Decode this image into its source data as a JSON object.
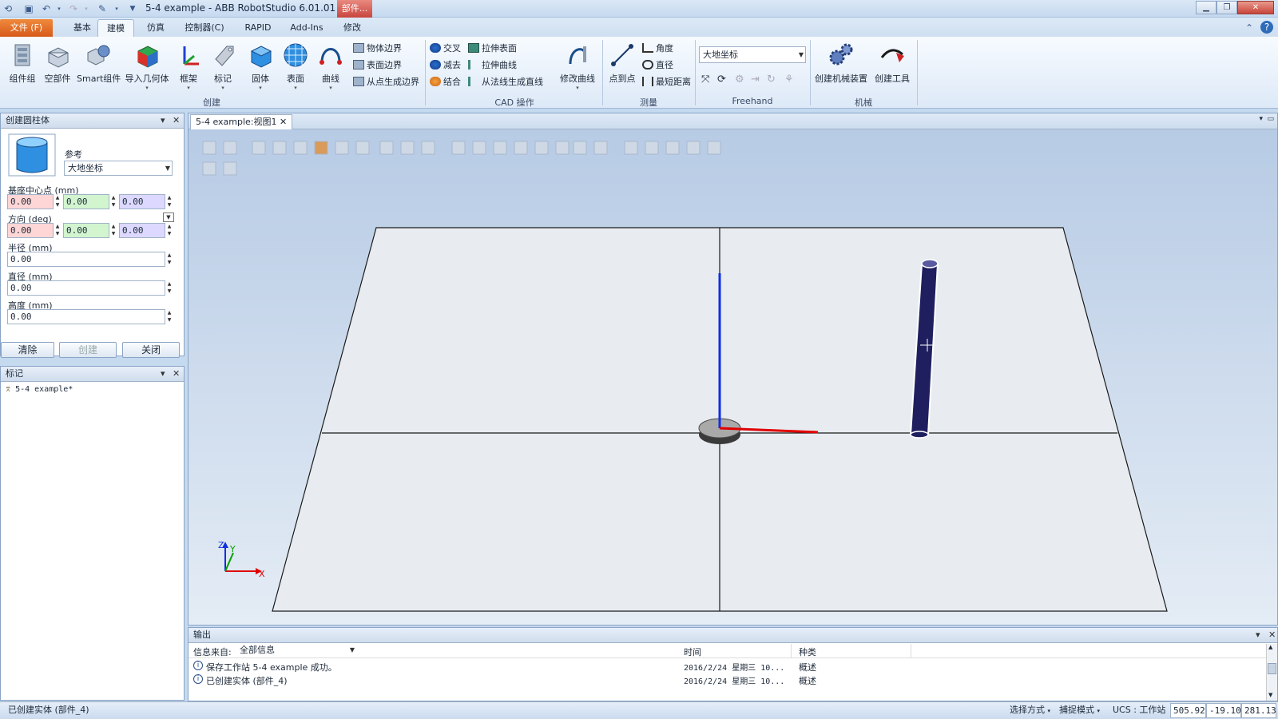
{
  "window": {
    "title": "5-4 example - ABB RobotStudio 6.01.01",
    "context_tab": "部件..."
  },
  "menu": {
    "tabs": [
      "文件 (F)",
      "基本",
      "建模",
      "仿真",
      "控制器(C)",
      "RAPID",
      "Add-Ins",
      "修改"
    ],
    "active_tab": "建模"
  },
  "ribbon": {
    "create": {
      "label": "创建",
      "buttons": [
        "组件组",
        "空部件",
        "Smart组件",
        "导入几何体",
        "框架",
        "标记",
        "固体",
        "表面",
        "曲线"
      ],
      "small": [
        "物体边界",
        "表面边界",
        "从点生成边界"
      ]
    },
    "cad": {
      "label": "CAD 操作",
      "small_left": [
        "交叉",
        "减去",
        "结合"
      ],
      "small_right": [
        "拉伸表面",
        "拉伸曲线",
        "从法线生成直线"
      ],
      "big": "修改曲线"
    },
    "measure": {
      "label": "测量",
      "big": "点到点",
      "small": [
        "角度",
        "直径",
        "最短距离"
      ]
    },
    "freehand": {
      "label": "Freehand",
      "combo": "大地坐标"
    },
    "mechanism": {
      "label": "机械",
      "buttons": [
        "创建机械装置",
        "创建工具"
      ]
    }
  },
  "cylinder_panel": {
    "title": "创建圆柱体",
    "ref_label": "参考",
    "ref_value": "大地坐标",
    "base_label": "基座中心点 (mm)",
    "base_values": [
      "0.00",
      "0.00",
      "0.00"
    ],
    "dir_label": "方向 (deg)",
    "dir_values": [
      "0.00",
      "0.00",
      "0.00"
    ],
    "radius_label": "半径 (mm)",
    "radius_value": "0.00",
    "diameter_label": "直径 (mm)",
    "diameter_value": "0.00",
    "height_label": "高度 (mm)",
    "height_value": "0.00",
    "btn_clear": "清除",
    "btn_create": "创建",
    "btn_close": "关闭"
  },
  "tags_panel": {
    "title": "标记",
    "item": "5-4 example*"
  },
  "view": {
    "tab": "5-4 example:视图1",
    "axis_z": "Z",
    "axis_y": "Y",
    "axis_x": "X"
  },
  "output": {
    "title": "输出",
    "source_label": "信息来自:",
    "source_value": "全部信息",
    "col_time": "时间",
    "col_type": "种类",
    "rows": [
      {
        "msg": "保存工作站 5-4 example 成功。",
        "time": "2016/2/24 星期三 10...",
        "type": "概述"
      },
      {
        "msg": "已创建实体 (部件_4)",
        "time": "2016/2/24 星期三 10...",
        "type": "概述"
      }
    ]
  },
  "status": {
    "left": "已创建实体 (部件_4)",
    "select": "选择方式",
    "snap": "捕捉模式",
    "ucs": "UCS : 工作站",
    "coords": [
      "505.92",
      "-19.10",
      "281.13"
    ]
  },
  "colors": {
    "accent": "#d7591b",
    "context": "#c8453e",
    "axis_x": "#e00000",
    "axis_y": "#00a000",
    "axis_z": "#1030e0",
    "cylinder": "#1f1f5f"
  }
}
